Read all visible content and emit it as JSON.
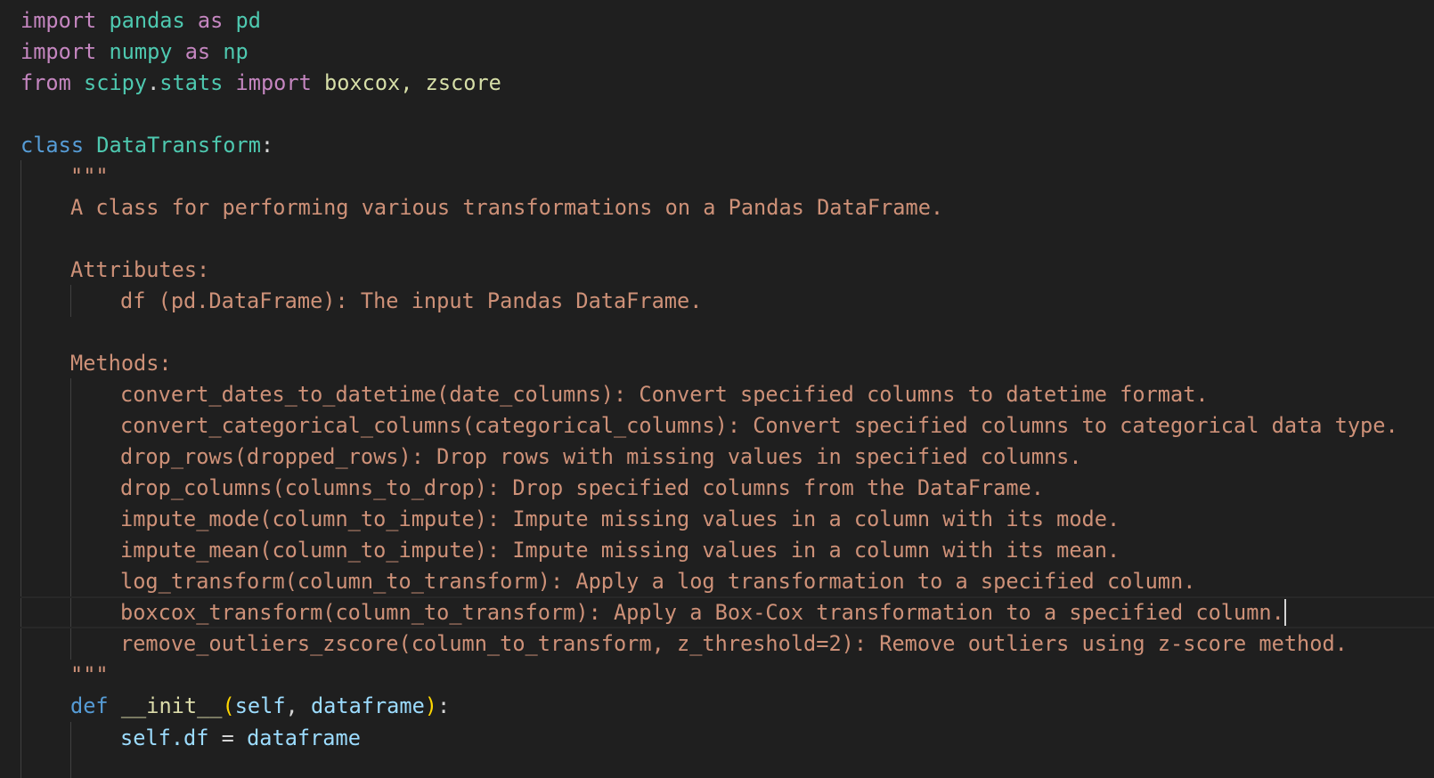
{
  "imports": [
    {
      "keyword": "import",
      "module": "pandas",
      "as_kw": "as",
      "alias": "pd"
    },
    {
      "keyword": "import",
      "module": "numpy",
      "as_kw": "as",
      "alias": "np"
    }
  ],
  "from_import": {
    "from_kw": "from",
    "module_part1": "scipy",
    "dot": ".",
    "module_part2": "stats",
    "import_kw": "import",
    "names": "boxcox, zscore"
  },
  "class_def": {
    "keyword": "class",
    "name": "DataTransform",
    "colon": ":"
  },
  "docstring": {
    "open_quotes": "\"\"\"",
    "summary": "A class for performing various transformations on a Pandas DataFrame.",
    "attributes_header": "Attributes:",
    "attributes": [
      "df (pd.DataFrame): The input Pandas DataFrame."
    ],
    "methods_header": "Methods:",
    "methods": [
      "convert_dates_to_datetime(date_columns): Convert specified columns to datetime format.",
      "convert_categorical_columns(categorical_columns): Convert specified columns to categorical data type.",
      "drop_rows(dropped_rows): Drop rows with missing values in specified columns.",
      "drop_columns(columns_to_drop): Drop specified columns from the DataFrame.",
      "impute_mode(column_to_impute): Impute missing values in a column with its mode.",
      "impute_mean(column_to_impute): Impute missing values in a column with its mean.",
      "log_transform(column_to_transform): Apply a log transformation to a specified column.",
      "boxcox_transform(column_to_transform): Apply a Box-Cox transformation to a specified column.",
      "remove_outliers_zscore(column_to_transform, z_threshold=2): Remove outliers using z-score method."
    ],
    "close_quotes": "\"\"\""
  },
  "init_def": {
    "keyword": "def",
    "name": "__init__",
    "open_paren": "(",
    "param1": "self",
    "comma": ", ",
    "param2": "dataframe",
    "close_paren": ")",
    "colon": ":"
  },
  "init_body": {
    "self_kw": "self",
    "attr": ".df",
    "assign": " = ",
    "value": "dataframe"
  },
  "colors": {
    "background": "#1f1f1f",
    "keyword": "#c586c0",
    "module": "#4ec9b0",
    "string": "#ce9178",
    "class_keyword": "#569cd6",
    "function": "#dcdcaa",
    "parameter": "#9cdcfe"
  }
}
